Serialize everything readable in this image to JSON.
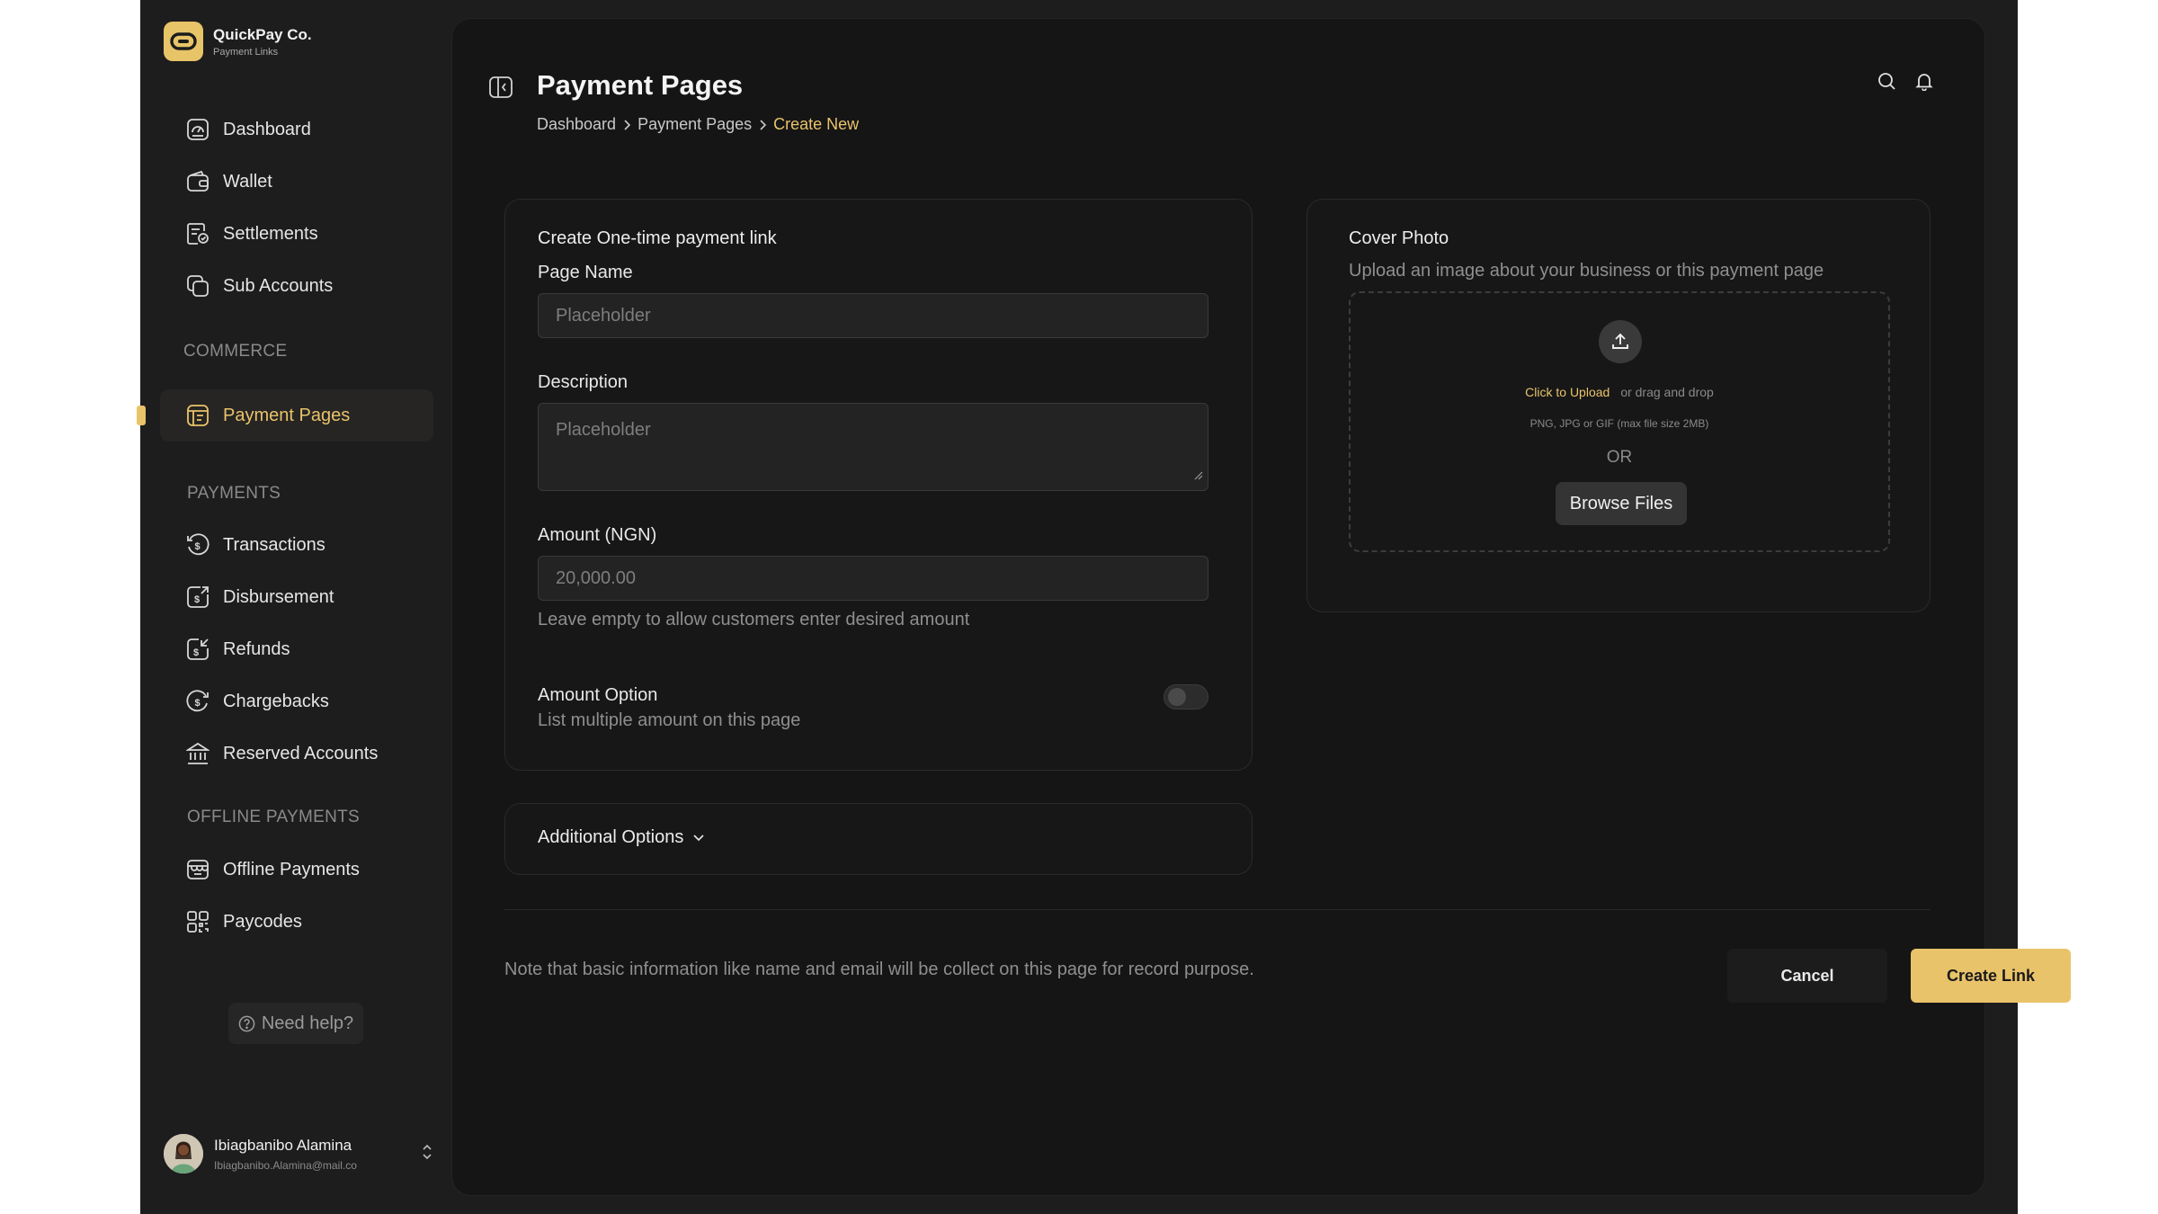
{
  "brand": {
    "name": "QuickPay Co.",
    "subtitle": "Payment Links"
  },
  "nav": {
    "main_items": [
      {
        "label": "Dashboard",
        "icon": "dashboard-icon"
      },
      {
        "label": "Wallet",
        "icon": "wallet-icon"
      },
      {
        "label": "Settlements",
        "icon": "settlements-icon"
      },
      {
        "label": "Sub Accounts",
        "icon": "sub-accounts-icon"
      }
    ],
    "commerce_label": "COMMERCE",
    "commerce_items": [
      {
        "label": "Payment Pages",
        "icon": "payment-pages-icon",
        "active": true
      }
    ],
    "payments_label": "PAYMENTS",
    "payments_items": [
      {
        "label": "Transactions",
        "icon": "transactions-icon"
      },
      {
        "label": "Disbursement",
        "icon": "disbursement-icon"
      },
      {
        "label": "Refunds",
        "icon": "refunds-icon"
      },
      {
        "label": "Chargebacks",
        "icon": "chargebacks-icon"
      },
      {
        "label": "Reserved Accounts",
        "icon": "bank-icon"
      }
    ],
    "offline_label": "OFFLINE PAYMENTS",
    "offline_items": [
      {
        "label": "Offline Payments",
        "icon": "store-icon"
      },
      {
        "label": "Paycodes",
        "icon": "qr-code-icon"
      }
    ]
  },
  "help": {
    "label": "Need help?"
  },
  "user": {
    "name": "Ibiagbanibo Alamina",
    "email": "Ibiagbanibo.Alamina@mail.co"
  },
  "header": {
    "title": "Payment Pages",
    "breadcrumb": [
      "Dashboard",
      "Payment Pages",
      "Create New"
    ]
  },
  "form": {
    "heading": "Create One-time payment link",
    "page_name": {
      "label": "Page Name",
      "placeholder": "Placeholder"
    },
    "description": {
      "label": "Description",
      "placeholder": "Placeholder"
    },
    "amount": {
      "label": "Amount (NGN)",
      "placeholder": "20,000.00",
      "helper": "Leave empty to allow customers enter desired amount"
    },
    "amount_option": {
      "label": "Amount Option",
      "helper": "List multiple amount on this page",
      "enabled": false
    },
    "additional_options": "Additional Options"
  },
  "cover": {
    "title": "Cover Photo",
    "subtitle": "Upload an image about your business or this payment page",
    "click_to_upload": "Click to Upload",
    "drag_text": "or drag and drop",
    "note": "PNG, JPG or GIF (max file size 2MB)",
    "or": "OR",
    "browse": "Browse Files"
  },
  "footer": {
    "note": "Note that basic information like name and email will be collect on this page for record purpose.",
    "cancel": "Cancel",
    "create": "Create Link"
  },
  "colors": {
    "accent": "#e9c36a",
    "background": "#151516",
    "sidebar": "#1d1d1e"
  }
}
